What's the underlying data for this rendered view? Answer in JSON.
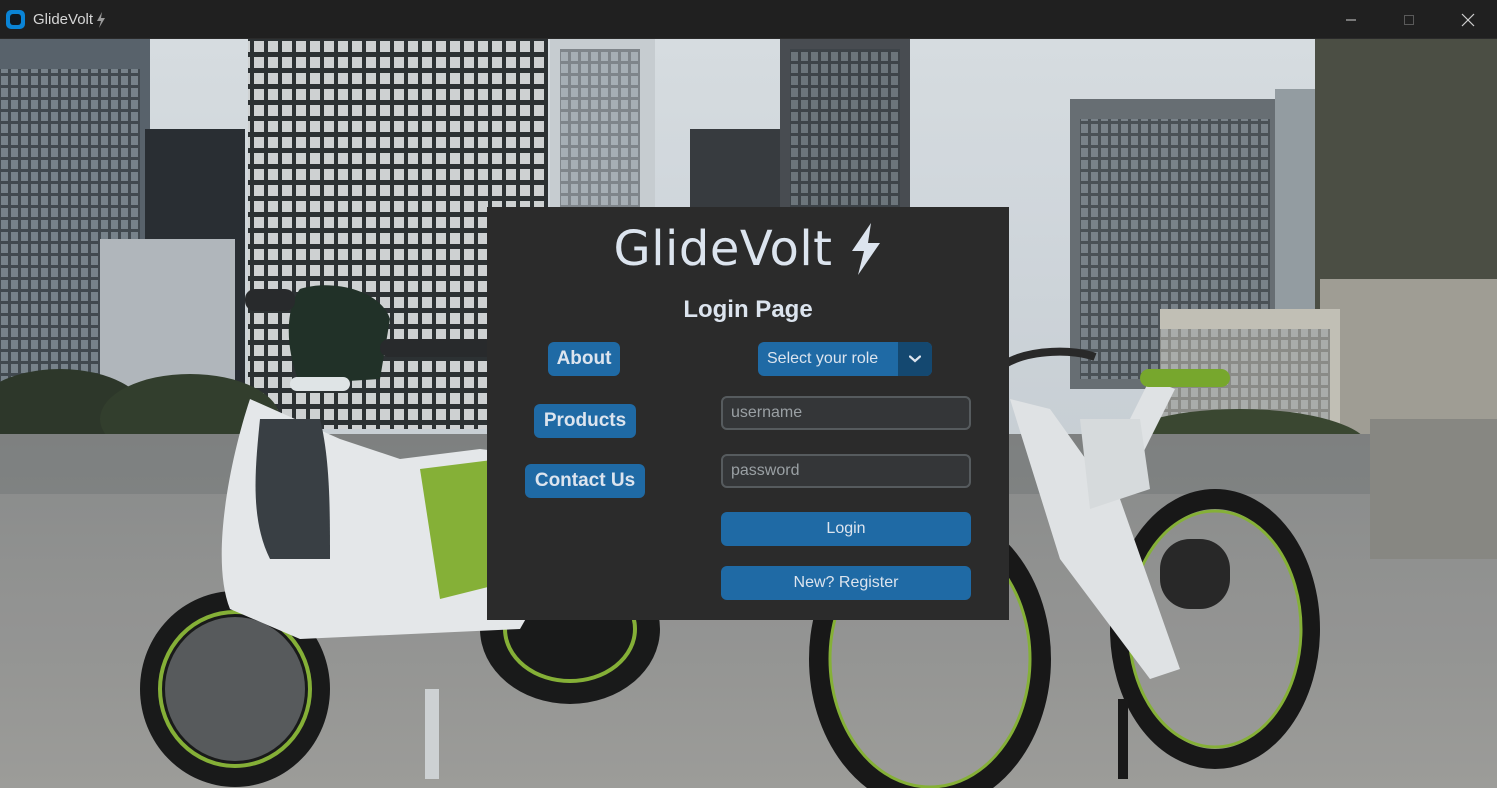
{
  "window": {
    "title": "GlideVolt",
    "icon": "app-icon",
    "controls": [
      "minimize-icon",
      "maximize-icon",
      "close-icon"
    ]
  },
  "background": {
    "description_icon": "city-scooter-bike-photo"
  },
  "panel": {
    "brand": "GlideVolt",
    "brand_icon": "lightning-bolt-icon",
    "page_title": "Login Page",
    "nav": {
      "about": "About",
      "products": "Products",
      "contact": "Contact Us"
    },
    "role_select": {
      "value": "Select your role"
    },
    "username": {
      "placeholder": "username",
      "value": ""
    },
    "password": {
      "placeholder": "password",
      "value": ""
    },
    "login_label": "Login",
    "register_label": "New? Register"
  },
  "colors": {
    "accent": "#1f6aa5",
    "accent_dark": "#144870",
    "panel_bg": "#2b2b2b",
    "text": "#dce4ee",
    "entry_bg": "#343638",
    "entry_border": "#565b5e"
  }
}
